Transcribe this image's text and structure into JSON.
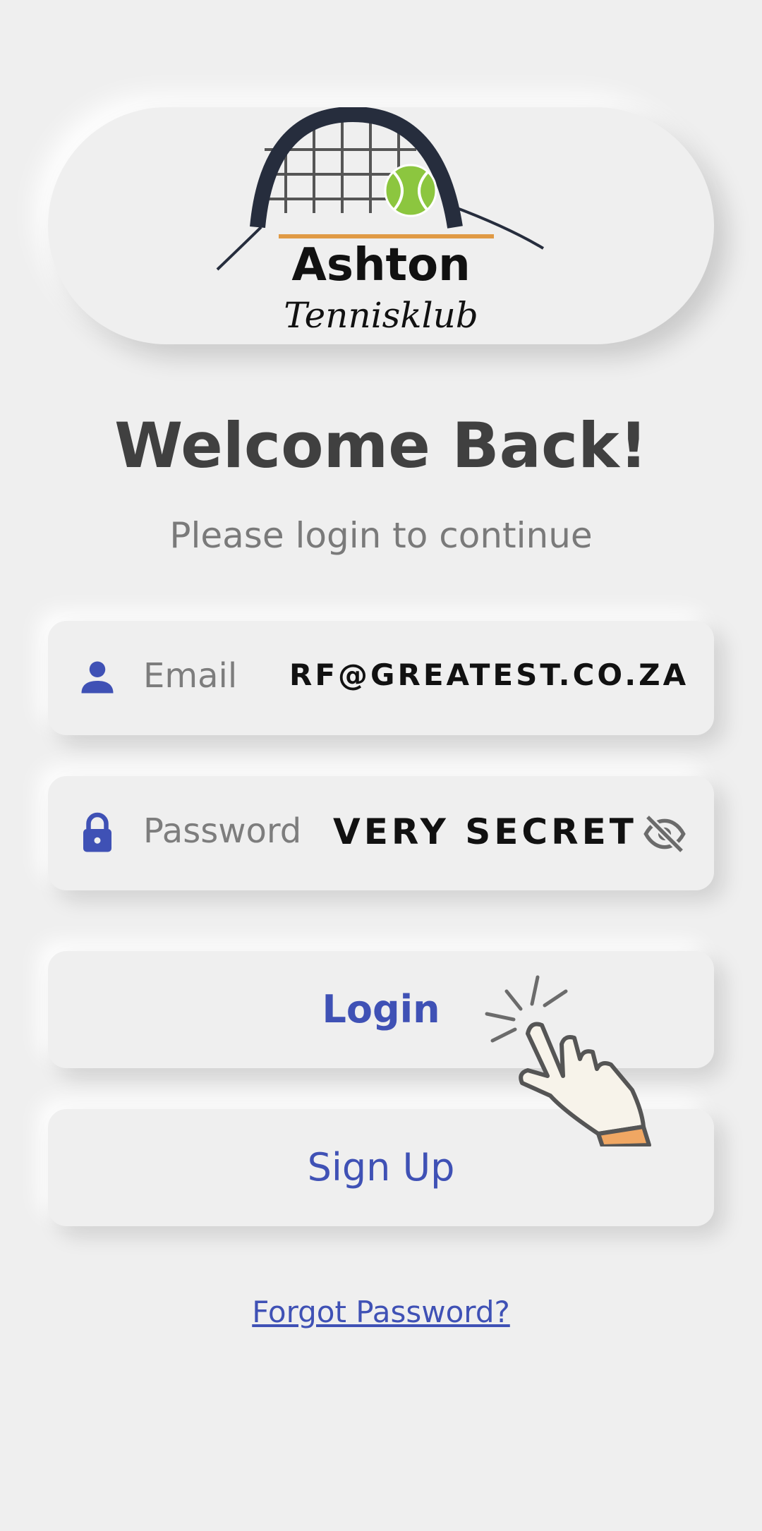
{
  "logo": {
    "brand_name": "Ashton",
    "brand_sub": "Tennisklub"
  },
  "header": {
    "title": "Welcome Back!",
    "subtitle": "Please login to continue"
  },
  "form": {
    "email": {
      "label": "Email",
      "value": "RF@GREATEST.CO.ZA",
      "icon": "person-icon"
    },
    "password": {
      "label": "Password",
      "value": "VERY SECRET",
      "icon": "lock-icon",
      "toggle_icon": "eye-off-icon"
    }
  },
  "actions": {
    "login_label": "Login",
    "signup_label": "Sign Up",
    "forgot_label": "Forgot Password?"
  },
  "colors": {
    "background": "#efefef",
    "accent": "#3f51b5",
    "title": "#404040",
    "muted": "#7a7a7a"
  }
}
